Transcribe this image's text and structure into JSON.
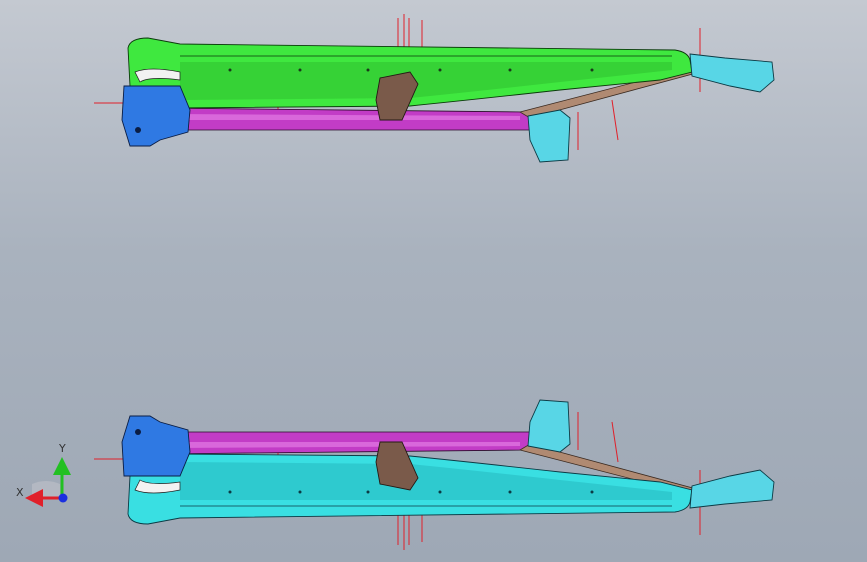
{
  "viewport": {
    "background_top": "#c4c9d1",
    "background_bottom": "#9ea8b5"
  },
  "parts": {
    "upper_frame": {
      "top_tube_color": "#3fe83f",
      "lower_tube_color": "#c23cc6",
      "node_color": "#2f79e3",
      "dropout_color": "#58d6e6"
    },
    "lower_frame": {
      "top_tube_color": "#39dfe2",
      "lower_tube_color": "#c23cc6",
      "node_color": "#2f79e3",
      "dropout_color": "#58d6e6"
    },
    "brace_color": "#7a5a4a",
    "edge_color": "#000000",
    "datum_line_color": "#e0202a"
  },
  "triad": {
    "x_label": "X",
    "y_label": "Y",
    "x_color": "#e0202a",
    "y_color": "#22c022",
    "z_color": "#1a2fe0"
  }
}
